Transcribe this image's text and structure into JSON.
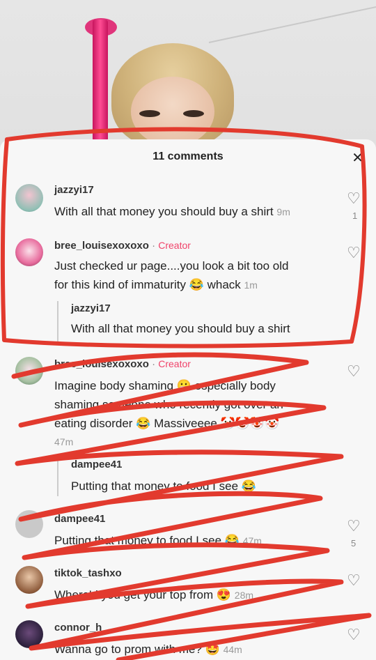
{
  "header": {
    "title": "11 comments",
    "close_icon": "close-icon"
  },
  "colors": {
    "creator": "#f0436a",
    "scribble": "#e23a2e",
    "pole": "#e0357b"
  },
  "comments": [
    {
      "user": "jazzyi17",
      "text": "With all that money you should buy a shirt",
      "time": "9m",
      "likes": "1"
    },
    {
      "user": "bree_louisexoxoxo",
      "badge": "Creator",
      "text_line1": "Just checked ur page....you look a bit too old",
      "text_line2": "for this kind of immaturity",
      "emoji": "😂",
      "text_tail": "whack",
      "time": "1m",
      "quote": {
        "user": "jazzyi17",
        "text": "With all that money you should buy a shirt"
      }
    },
    {
      "user": "bree_louisexoxoxo",
      "badge": "Creator",
      "text_line1": "Imagine body shaming",
      "text_line1b": "especially body",
      "text_line2": "shaming someone who recently got over an",
      "text_line3": "eating disorder",
      "text_line3b": "Massiveeee",
      "time": "47m",
      "quote": {
        "user": "dampee41",
        "text": "Putting that money to food I see"
      }
    },
    {
      "user": "dampee41",
      "text": "Putting that money to food I see",
      "emoji": "😂",
      "time": "47m",
      "likes": "5"
    },
    {
      "user": "tiktok_tashxo",
      "text": "Where'd you get your top from",
      "emoji": "😍",
      "time": "28m"
    },
    {
      "user": "connor_h",
      "text": "Wanna go to prom with me?",
      "emoji": "🤩",
      "time": "44m"
    }
  ]
}
